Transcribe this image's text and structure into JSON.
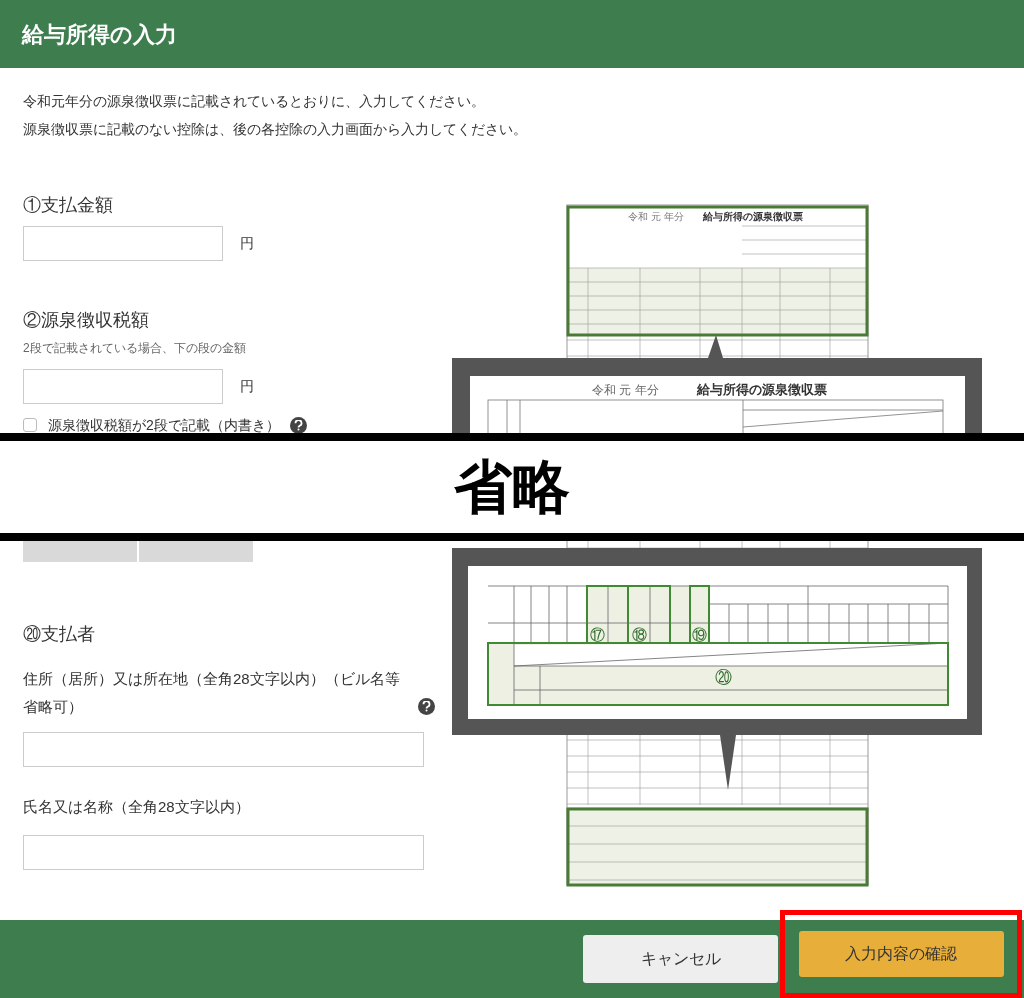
{
  "header": {
    "title": "給与所得の入力"
  },
  "intro": [
    "令和元年分の源泉徴収票に記載されているとおりに、入力してください。",
    "源泉徴収票に記載のない控除は、後の各控除の入力画面から入力してください。"
  ],
  "payment": {
    "heading": "①支払金額",
    "unit": "円"
  },
  "withholding": {
    "heading": "②源泉徴収税額",
    "note": "2段で記載されている場合、下の段の金額",
    "unit": "円",
    "checkbox": {
      "label": "源泉徴収税額が2段で記載（内書き）",
      "checked": false,
      "help": true
    }
  },
  "payer": {
    "heading": "⑳支払者",
    "fields": [
      {
        "label": "住所（居所）又は所在地（全角28文字以内）（ビル名等省略可）",
        "help": true
      },
      {
        "label": "氏名又は名称（全角28文字以内）",
        "help": false
      }
    ]
  },
  "illustration": {
    "slip_era": "令和 元 年分",
    "slip_title": "給与所得の源泉徴収票",
    "callout_era": "令和 元 年分",
    "callout_title": "給与所得の源泉徴収票",
    "markers": [
      "⑰",
      "⑱",
      "⑲",
      "⑳"
    ]
  },
  "omission": {
    "label": "省略"
  },
  "footer": {
    "buttons": [
      {
        "label": "キャンセル",
        "kind": "secondary",
        "highlighted": false
      },
      {
        "label": "入力内容の確認",
        "kind": "primary",
        "highlighted": true
      }
    ]
  }
}
